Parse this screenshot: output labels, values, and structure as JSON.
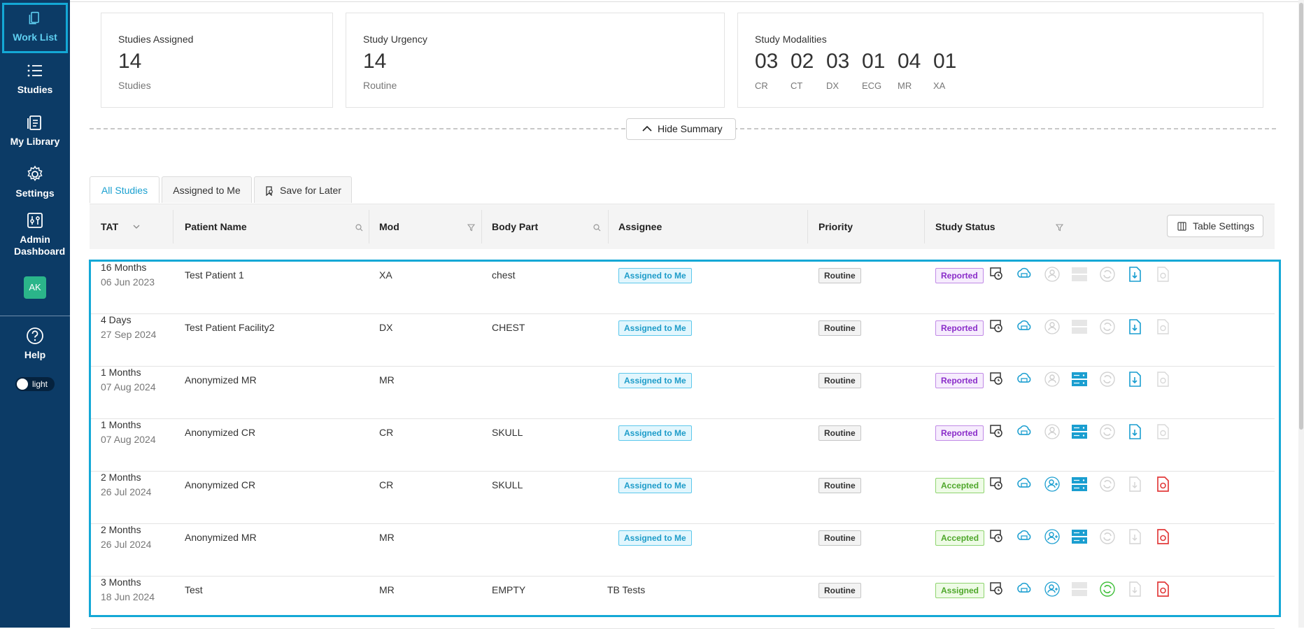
{
  "sidebar": {
    "items": [
      {
        "label": "Work List",
        "icon": "worklist-icon"
      },
      {
        "label": "Studies",
        "icon": "list-icon"
      },
      {
        "label": "My Library",
        "icon": "library-icon"
      },
      {
        "label": "Settings",
        "icon": "gear-icon"
      },
      {
        "label": "Admin Dashboard",
        "icon": "sliders-icon"
      }
    ],
    "avatar": "AK",
    "help": "Help",
    "theme": "light"
  },
  "summary": {
    "assigned": {
      "title": "Studies Assigned",
      "value": "14",
      "sub": "Studies"
    },
    "urgency": {
      "title": "Study Urgency",
      "value": "14",
      "sub": "Routine"
    },
    "modalities": {
      "title": "Study Modalities",
      "items": [
        {
          "value": "03",
          "label": "CR"
        },
        {
          "value": "02",
          "label": "CT"
        },
        {
          "value": "03",
          "label": "DX"
        },
        {
          "value": "01",
          "label": "ECG"
        },
        {
          "value": "04",
          "label": "MR"
        },
        {
          "value": "01",
          "label": "XA"
        }
      ]
    },
    "hide_label": "Hide Summary"
  },
  "tabs": [
    {
      "label": "All Studies"
    },
    {
      "label": "Assigned to Me"
    },
    {
      "label": "Save for Later"
    }
  ],
  "table": {
    "headers": {
      "tat": "TAT",
      "patient": "Patient Name",
      "mod": "Mod",
      "body": "Body Part",
      "assignee": "Assignee",
      "priority": "Priority",
      "status": "Study Status"
    },
    "settings_label": "Table Settings",
    "rows": [
      {
        "tat": "16 Months",
        "date": "06 Jun 2023",
        "patient": "Test Patient 1",
        "mod": "XA",
        "body": "chest",
        "assignee": "Assigned to Me",
        "priority": "Routine",
        "status": "Reported"
      },
      {
        "tat": "4 Days",
        "date": "27 Sep 2024",
        "patient": "Test Patient Facility2",
        "mod": "DX",
        "body": "CHEST",
        "assignee": "Assigned to Me",
        "priority": "Routine",
        "status": "Reported"
      },
      {
        "tat": "1 Months",
        "date": "07 Aug 2024",
        "patient": "Anonymized MR",
        "mod": "MR",
        "body": "",
        "assignee": "Assigned to Me",
        "priority": "Routine",
        "status": "Reported"
      },
      {
        "tat": "1 Months",
        "date": "07 Aug 2024",
        "patient": "Anonymized CR",
        "mod": "CR",
        "body": "SKULL",
        "assignee": "Assigned to Me",
        "priority": "Routine",
        "status": "Reported"
      },
      {
        "tat": "2 Months",
        "date": "26 Jul 2024",
        "patient": "Anonymized CR",
        "mod": "CR",
        "body": "SKULL",
        "assignee": "Assigned to Me",
        "priority": "Routine",
        "status": "Accepted"
      },
      {
        "tat": "2 Months",
        "date": "26 Jul 2024",
        "patient": "Anonymized MR",
        "mod": "MR",
        "body": "",
        "assignee": "Assigned to Me",
        "priority": "Routine",
        "status": "Accepted"
      },
      {
        "tat": "3 Months",
        "date": "18 Jun 2024",
        "patient": "Test",
        "mod": "MR",
        "body": "EMPTY",
        "assignee": "TB Tests",
        "priority": "Routine",
        "status": "Assigned"
      }
    ]
  },
  "colors": {
    "sidebar_bg": "#0c3b66",
    "accent": "#14a8d6",
    "reported": "#8a2cc9",
    "accepted": "#4ea72a",
    "danger": "#e23b3b"
  }
}
